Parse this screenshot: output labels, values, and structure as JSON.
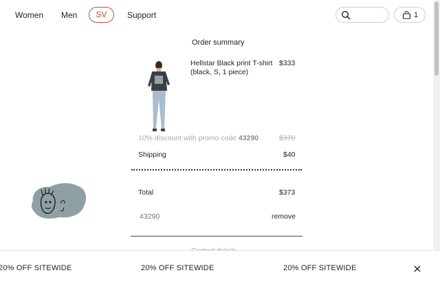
{
  "nav": {
    "items": [
      {
        "label": "Women"
      },
      {
        "label": "Men"
      },
      {
        "label": "SV"
      },
      {
        "label": "Support"
      }
    ],
    "search_icon": "search-icon",
    "cart_icon": "bag-icon",
    "cart_count": "1"
  },
  "summary": {
    "title": "Order summary",
    "product": {
      "name": "Hellstar Black print T-shirt (black, S, 1 piece)",
      "price": "$333"
    },
    "discount": {
      "text": "10% discount with promo code ",
      "code": "43290",
      "old_price": "$370"
    },
    "shipping": {
      "label": "Shipping",
      "value": "$40"
    },
    "total": {
      "label": "Total",
      "value": "$373"
    },
    "promo": {
      "code": "43290",
      "remove_label": "remove"
    },
    "next_section_peek": "Contact details"
  },
  "banner": {
    "items": [
      "20% OFF SITEWIDE",
      "20% OFF SITEWIDE",
      "20% OFF SITEWIDE"
    ],
    "close_icon": "close-icon"
  },
  "colors": {
    "accent": "#c94a3a",
    "muted": "#a9a9a9"
  }
}
